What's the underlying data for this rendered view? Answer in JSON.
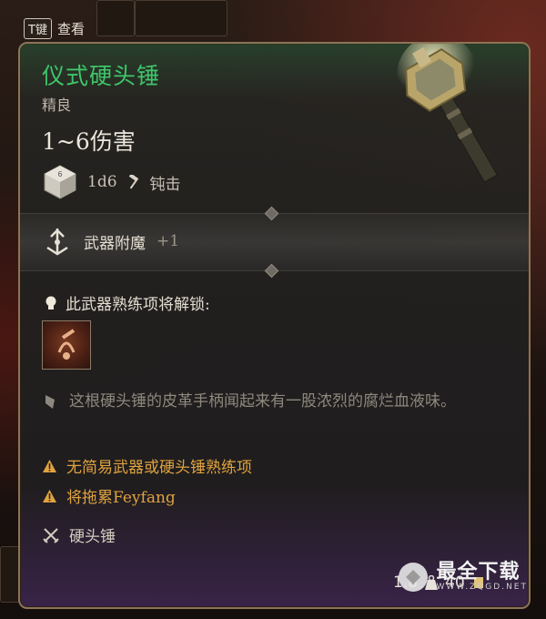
{
  "hint": {
    "key": "T键",
    "label": "查看"
  },
  "item": {
    "name": "仪式硬头锤",
    "rarity": "精良",
    "damage": "1~6伤害",
    "damage_dice": "1d6",
    "damage_type": "钝击",
    "enchant_label": "武器附魔",
    "enchant_value": "+1",
    "unlock_text": "此武器熟练项将解锁:",
    "flavor": "这根硬头锤的皮革手柄闻起来有一股浓烈的腐烂血液味。",
    "warnings": [
      "无简易武器或硬头锤熟练项",
      "将拖累Feyfang"
    ],
    "weapon_type": "硬头锤",
    "weight": "1.8",
    "value": "40"
  },
  "watermark": {
    "title": "最全下载",
    "url": "WWW.ZQGD.NET"
  },
  "colors": {
    "title": "#3fc56a",
    "warning": "#e0a33f",
    "border": "#8c7457"
  },
  "icons": [
    "die-icon",
    "hammer-icon",
    "enchant-icon",
    "bulb-icon",
    "proficiency-icon",
    "quill-icon",
    "warning-icon",
    "crossed-swords-icon",
    "weight-icon",
    "coin-icon"
  ]
}
